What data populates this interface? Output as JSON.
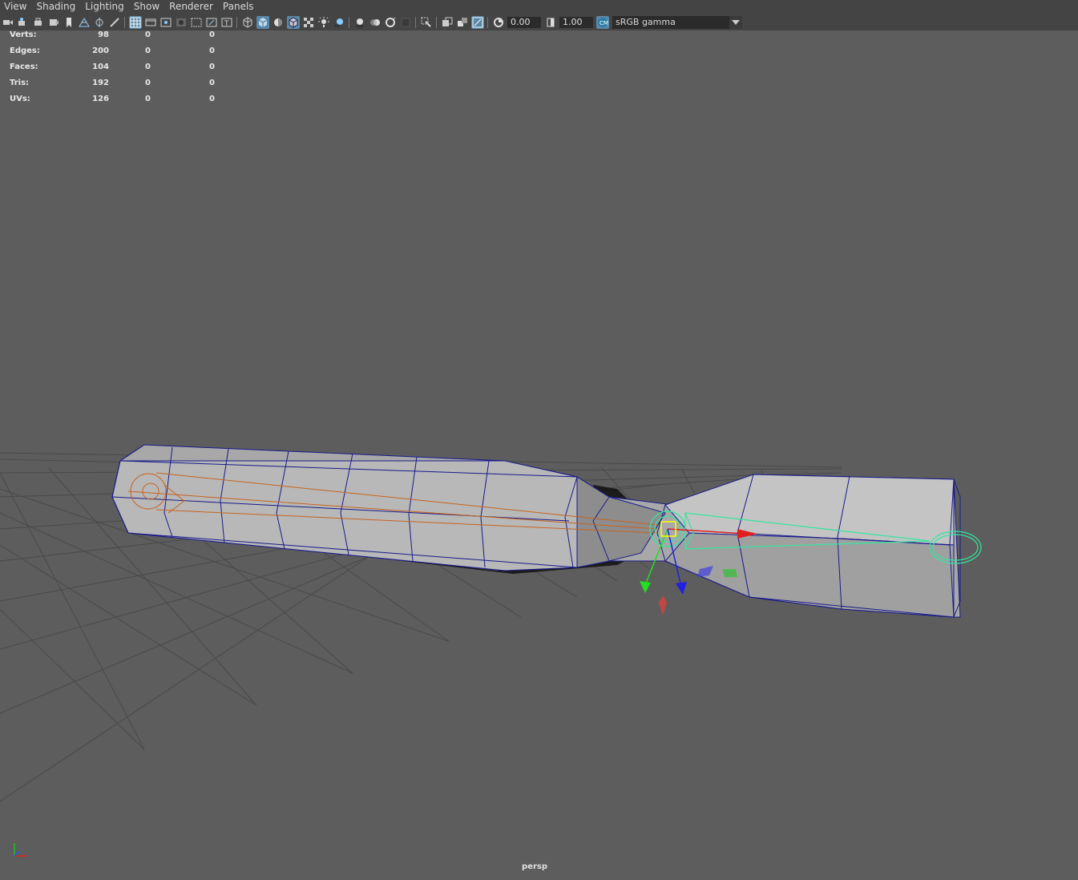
{
  "menubar": {
    "items": [
      "View",
      "Shading",
      "Lighting",
      "Show",
      "Renderer",
      "Panels"
    ]
  },
  "toolbar": {
    "exposure_value": "0.00",
    "gamma_value": "1.00",
    "color_space": "sRGB gamma"
  },
  "hud": {
    "rows": [
      {
        "label": "Verts:",
        "values": [
          "98",
          "0",
          "0"
        ]
      },
      {
        "label": "Edges:",
        "values": [
          "200",
          "0",
          "0"
        ]
      },
      {
        "label": "Faces:",
        "values": [
          "104",
          "0",
          "0"
        ]
      },
      {
        "label": "Tris:",
        "values": [
          "192",
          "0",
          "0"
        ]
      },
      {
        "label": "UVs:",
        "values": [
          "126",
          "0",
          "0"
        ]
      }
    ]
  },
  "viewport": {
    "camera_name": "persp"
  },
  "colors": {
    "viewport_bg": "#5d5d5d",
    "panel_bg": "#444444",
    "wire_blue": "#1a1a8c",
    "joint_orange": "#c8641e",
    "selection_green": "#33e6a0"
  }
}
